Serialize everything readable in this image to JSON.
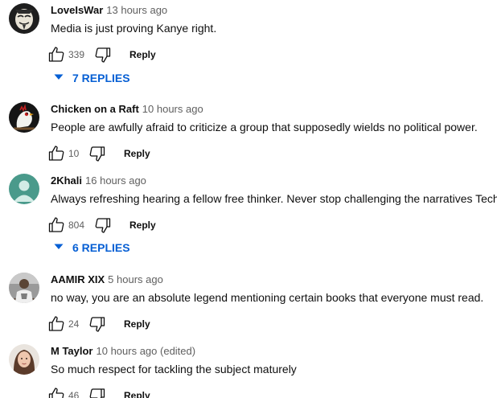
{
  "comments": [
    {
      "author": "LoveIsWar",
      "time": "13 hours ago",
      "text": "Media is just proving Kanye right.",
      "likes": "339",
      "reply_label": "Reply",
      "replies_label": "7 REPLIES",
      "avatar_icon": "masked-face-icon"
    },
    {
      "author": "Chicken on a Raft",
      "time": "10 hours ago",
      "text": "People are awfully afraid to criticize a group that supposedly wields no political power.",
      "likes": "10",
      "reply_label": "Reply",
      "avatar_icon": "chicken-avatar-icon"
    },
    {
      "author": "2Khali",
      "time": "16 hours ago",
      "text": "Always refreshing hearing a fellow free thinker. Never stop challenging the narratives Tech",
      "emoji_icon": "victory-hand-icon",
      "likes": "804",
      "reply_label": "Reply",
      "replies_label": "6 REPLIES",
      "avatar_icon": "default-user-icon"
    },
    {
      "author": "AAMIR XIX",
      "time": "5 hours ago",
      "text": "no way, you are an absolute legend mentioning certain books that everyone must read.",
      "likes": "24",
      "reply_label": "Reply",
      "avatar_icon": "photo-avatar-icon"
    },
    {
      "author": "M Taylor",
      "time": "10 hours ago (edited)",
      "text": "So much respect for tackling the subject maturely",
      "likes": "46",
      "reply_label": "Reply",
      "avatar_icon": "portrait-avatar-icon"
    }
  ],
  "colors": {
    "link_blue": "#065fd4",
    "meta_gray": "#606060",
    "text": "#0f0f0f",
    "default_avatar_bg": "#4a9a8b"
  }
}
